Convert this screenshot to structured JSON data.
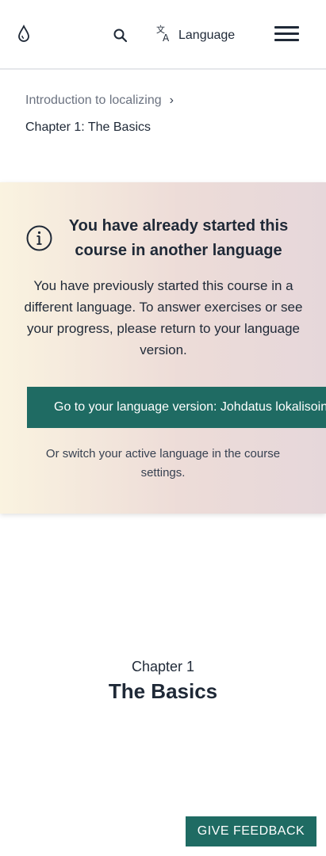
{
  "header": {
    "logo_icon": "drop-logo-icon",
    "search_icon": "search-icon",
    "language_icon": "translate-icon",
    "language_label": "Language",
    "menu_icon": "hamburger-menu-icon"
  },
  "breadcrumb": {
    "parent": "Introduction to localizing",
    "separator": "›",
    "current": "Chapter 1: The Basics"
  },
  "notice": {
    "icon": "info-icon",
    "title": "You have already started this course in another language",
    "body": "You have previously started this course in a different language. To answer exercises or see your progress, please return to your language version.",
    "button_label": "Go to your language version: Johdatus lokalisointiin",
    "switch_note": "Or switch your active language in the course settings."
  },
  "chapter": {
    "kicker": "Chapter 1",
    "title": "The Basics"
  },
  "feedback": {
    "label": "GIVE FEEDBACK"
  },
  "colors": {
    "accent": "#1f6b63",
    "text": "#1f2937",
    "muted": "#6b7280"
  }
}
